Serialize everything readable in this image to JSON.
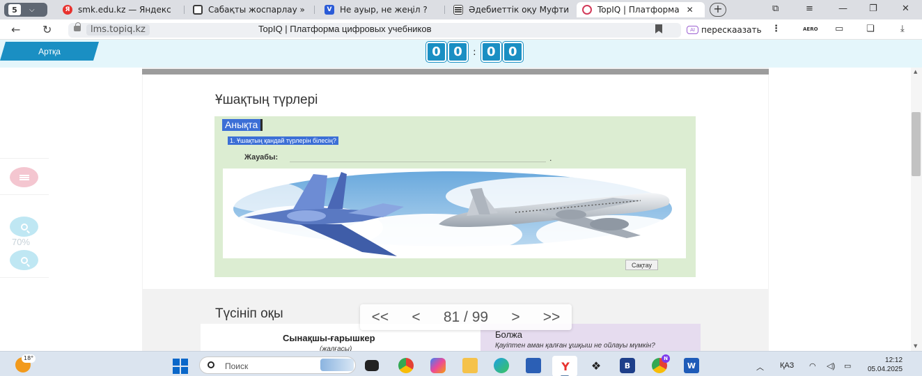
{
  "browser": {
    "tab_count": "5",
    "tabs": [
      {
        "label": "smk.edu.kz — Яндекс",
        "favicon": "yandex-icon",
        "color": "#e8322e"
      },
      {
        "label": "Сабақты жоспарлау »",
        "favicon": "document-icon",
        "color": "#3a3a3a"
      },
      {
        "label": "Не ауыр, не жеңіл ?",
        "favicon": "blue-v-icon",
        "color": "#2a5bd7"
      },
      {
        "label": "Әдебиеттік оқу Муфти",
        "favicon": "book-icon",
        "color": "#444444"
      },
      {
        "label": "TopIQ | Платформа",
        "favicon": "topiq-icon",
        "color": "#d23b5a",
        "active": true
      }
    ],
    "url_domain": "lms.topiq.kz",
    "page_title": "TopIQ | Платформа цифровых учебников",
    "retell_label": "перескаазать",
    "retell_badge": "AI",
    "aero_label": "AERO"
  },
  "header": {
    "back_label": "Артқа",
    "timer": [
      "0",
      "0",
      "0",
      "0"
    ],
    "timer_separator": ":"
  },
  "tools": {
    "zoom_level": "70%"
  },
  "lesson": {
    "section_title": "Ұшақтың түрлері",
    "task_tag": "Анықта",
    "question": "1. Ұшақтың қандай түрлерін білесің?",
    "answer_label": "Жауабы:",
    "answer_value": "",
    "answer_dot": ".",
    "save_label": "Сақтау",
    "section2_title": "Түсініп оқы",
    "card_left_title": "Сынақшы-ғарышкер",
    "card_left_sub": "(жалғасы)",
    "card_right_title": "Болжа",
    "card_right_sub": "Қауіптен аман қалған ұшқыш не ойлауы мүмкін?"
  },
  "pager": {
    "first": "<<",
    "prev": "<",
    "current": "81",
    "separator": "/",
    "total": "99",
    "next": ">",
    "last": ">>"
  },
  "taskbar": {
    "weather_temp": "18°",
    "search_placeholder": "Поиск",
    "lang": "ҚАЗ",
    "time": "12:12",
    "date": "05.04.2025",
    "notif_badge": "N"
  },
  "colors": {
    "accent": "#1a8fc3",
    "green_panel": "#dcedd2",
    "highlight": "#3c6fd6",
    "card_purple": "#e6dcef"
  }
}
